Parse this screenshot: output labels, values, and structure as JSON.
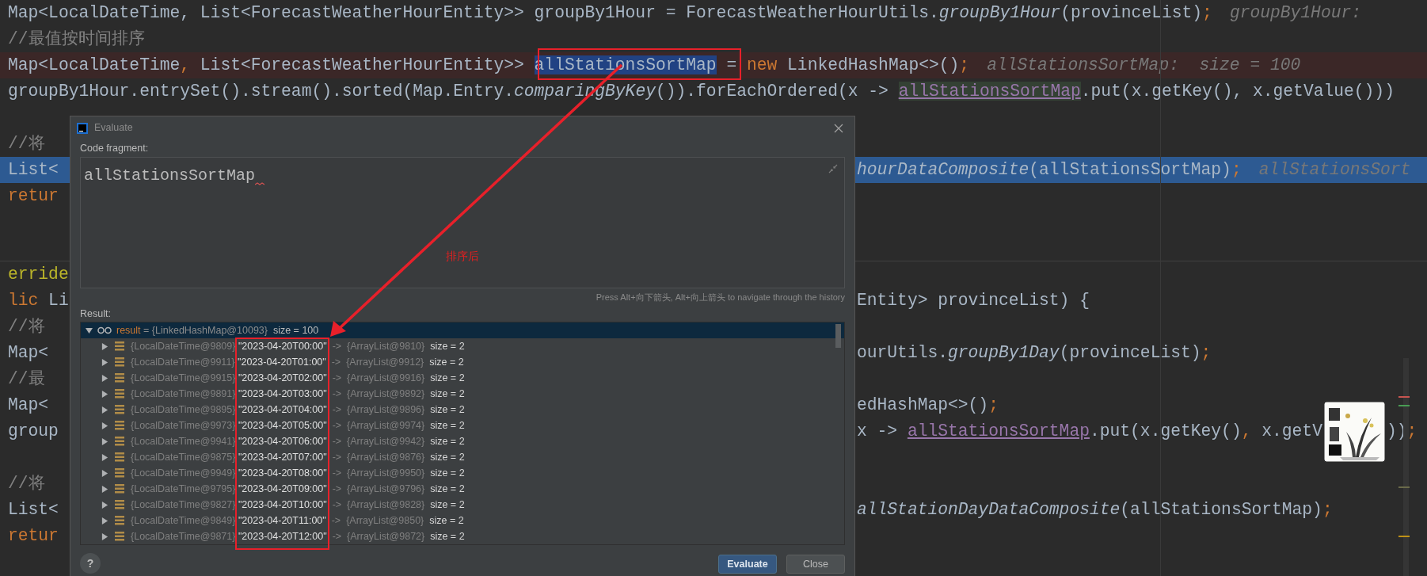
{
  "editor": {
    "lines": [
      {
        "kind": "plain",
        "left": [
          {
            "kind": "plain",
            "text": "Map<LocalDateTime, List<ForecastWeatherHourEntity>> groupBy1Hour = ForecastWeatherHourUtils."
          },
          {
            "kind": "italic",
            "text": "groupBy1Hour"
          },
          {
            "kind": "plain",
            "text": "(provinceList)"
          },
          {
            "kind": "keyword",
            "text": ";"
          },
          {
            "kind": "hint",
            "text": "groupBy1Hour:"
          }
        ]
      },
      {
        "kind": "plain",
        "left": [
          {
            "kind": "comment",
            "text": "//最值按时间排序"
          }
        ]
      },
      {
        "kind": "breakpoint",
        "left": [
          {
            "kind": "plain",
            "text": "Map<LocalDateTime"
          },
          {
            "kind": "keyword",
            "text": ","
          },
          {
            "kind": "plain",
            "text": " List<ForecastWeatherHourEntity>> "
          },
          {
            "kind": "selected",
            "text": "allStationsSortMap"
          },
          {
            "kind": "plain",
            "text": " = "
          },
          {
            "kind": "keyword",
            "text": "new"
          },
          {
            "kind": "plain",
            "text": " LinkedHashMap<>()"
          },
          {
            "kind": "keyword",
            "text": ";"
          },
          {
            "kind": "hint",
            "text": "allStationsSortMap:  size = 100"
          }
        ]
      },
      {
        "kind": "plain",
        "left": [
          {
            "kind": "plain",
            "text": "groupBy1Hour.entrySet().stream().sorted(Map.Entry."
          },
          {
            "kind": "italic",
            "text": "comparingByKey"
          },
          {
            "kind": "plain",
            "text": "()).forEachOrdered(x -> "
          },
          {
            "kind": "usage",
            "text": "allStationsSortMap"
          },
          {
            "kind": "plain",
            "text": ".put(x.getKey(), x.getValue()))"
          }
        ]
      },
      {
        "kind": "plain"
      },
      {
        "kind": "plain",
        "left": [
          {
            "kind": "comment",
            "text": "//将"
          }
        ]
      },
      {
        "kind": "execution",
        "left": [
          {
            "kind": "plain",
            "text": "List<"
          }
        ],
        "right": [
          {
            "kind": "italic",
            "text": "hourDataComposite"
          },
          {
            "kind": "plain",
            "text": "(allStationsSortMap)"
          },
          {
            "kind": "keyword",
            "text": ";"
          },
          {
            "kind": "hint",
            "text": "allStationsSort"
          }
        ]
      },
      {
        "kind": "plain",
        "left": [
          {
            "kind": "keyword",
            "text": "retur"
          }
        ]
      },
      {
        "kind": "plain"
      },
      {
        "kind": "divider"
      },
      {
        "kind": "plain",
        "left": [
          {
            "kind": "annotation",
            "text": "erride"
          }
        ]
      },
      {
        "kind": "plain",
        "left": [
          {
            "kind": "keyword",
            "text": "lic"
          },
          {
            "kind": "plain",
            "text": " Li"
          }
        ],
        "right": [
          {
            "kind": "plain",
            "text": "Entity> provinceList) {"
          }
        ]
      },
      {
        "kind": "plain",
        "left": [
          {
            "kind": "comment",
            "text": "//将"
          }
        ]
      },
      {
        "kind": "plain",
        "left": [
          {
            "kind": "plain",
            "text": "Map<"
          }
        ],
        "right": [
          {
            "kind": "plain",
            "text": "ourUtils."
          },
          {
            "kind": "italic",
            "text": "groupBy1Day"
          },
          {
            "kind": "plain",
            "text": "(provinceList)"
          },
          {
            "kind": "keyword",
            "text": ";"
          }
        ]
      },
      {
        "kind": "plain",
        "left": [
          {
            "kind": "comment",
            "text": "//最"
          }
        ]
      },
      {
        "kind": "plain",
        "left": [
          {
            "kind": "plain",
            "text": "Map<"
          }
        ],
        "right": [
          {
            "kind": "plain",
            "text": "edHashMap<>()"
          },
          {
            "kind": "keyword",
            "text": ";"
          }
        ]
      },
      {
        "kind": "plain",
        "left": [
          {
            "kind": "plain",
            "text": "group"
          }
        ],
        "right": [
          {
            "kind": "plain",
            "text": "x -> "
          },
          {
            "kind": "field",
            "text": "allStationsSortMap"
          },
          {
            "kind": "plain",
            "text": ".put(x.getKey()"
          },
          {
            "kind": "keyword",
            "text": ","
          },
          {
            "kind": "plain",
            "text": " x.getV"
          },
          {
            "kind": "picture"
          },
          {
            "kind": "plain",
            "text": "))"
          },
          {
            "kind": "keyword",
            "text": ";"
          }
        ]
      },
      {
        "kind": "plain"
      },
      {
        "kind": "plain",
        "left": [
          {
            "kind": "comment",
            "text": "//将"
          }
        ]
      },
      {
        "kind": "plain",
        "left": [
          {
            "kind": "plain",
            "text": "List<"
          }
        ],
        "right": [
          {
            "kind": "italic",
            "text": "allStationDayDataComposite"
          },
          {
            "kind": "plain",
            "text": "(allStationsSortMap)"
          },
          {
            "kind": "keyword",
            "text": ";"
          }
        ]
      },
      {
        "kind": "plain",
        "left": [
          {
            "kind": "keyword",
            "text": "retur"
          }
        ]
      }
    ]
  },
  "dialog": {
    "title": "Evaluate",
    "code_label": "Code fragment:",
    "code": "allStationsSortMap",
    "note": "排序后",
    "hint": "Press Alt+向下箭头, Alt+向上箭头 to navigate through the history",
    "result_label": "Result:",
    "result": {
      "selected": true,
      "expanded": true,
      "name": "result",
      "value": " = {LinkedHashMap@10093}",
      "size": "size = 100",
      "children": [
        {
          "selected": false,
          "expanded": false,
          "key_id": "{LocalDateTime@9809}",
          "key": "\"2023-04-20T00:00\"",
          "arrow": "->",
          "value": "{ArrayList@9810}",
          "size": "size = 2"
        },
        {
          "selected": false,
          "expanded": false,
          "key_id": "{LocalDateTime@9911}",
          "key": "\"2023-04-20T01:00\"",
          "arrow": "->",
          "value": "{ArrayList@9912}",
          "size": "size = 2"
        },
        {
          "selected": false,
          "expanded": false,
          "key_id": "{LocalDateTime@9915}",
          "key": "\"2023-04-20T02:00\"",
          "arrow": "->",
          "value": "{ArrayList@9916}",
          "size": "size = 2"
        },
        {
          "selected": false,
          "expanded": false,
          "key_id": "{LocalDateTime@9891}",
          "key": "\"2023-04-20T03:00\"",
          "arrow": "->",
          "value": "{ArrayList@9892}",
          "size": "size = 2"
        },
        {
          "selected": false,
          "expanded": false,
          "key_id": "{LocalDateTime@9895}",
          "key": "\"2023-04-20T04:00\"",
          "arrow": "->",
          "value": "{ArrayList@9896}",
          "size": "size = 2"
        },
        {
          "selected": false,
          "expanded": false,
          "key_id": "{LocalDateTime@9973}",
          "key": "\"2023-04-20T05:00\"",
          "arrow": "->",
          "value": "{ArrayList@9974}",
          "size": "size = 2"
        },
        {
          "selected": false,
          "expanded": false,
          "key_id": "{LocalDateTime@9941}",
          "key": "\"2023-04-20T06:00\"",
          "arrow": "->",
          "value": "{ArrayList@9942}",
          "size": "size = 2"
        },
        {
          "selected": false,
          "expanded": false,
          "key_id": "{LocalDateTime@9875}",
          "key": "\"2023-04-20T07:00\"",
          "arrow": "->",
          "value": "{ArrayList@9876}",
          "size": "size = 2"
        },
        {
          "selected": false,
          "expanded": false,
          "key_id": "{LocalDateTime@9949}",
          "key": "\"2023-04-20T08:00\"",
          "arrow": "->",
          "value": "{ArrayList@9950}",
          "size": "size = 2"
        },
        {
          "selected": false,
          "expanded": false,
          "key_id": "{LocalDateTime@9795}",
          "key": "\"2023-04-20T09:00\"",
          "arrow": "->",
          "value": "{ArrayList@9796}",
          "size": "size = 2"
        },
        {
          "selected": false,
          "expanded": false,
          "key_id": "{LocalDateTime@9827}",
          "key": "\"2023-04-20T10:00\"",
          "arrow": "->",
          "value": "{ArrayList@9828}",
          "size": "size = 2"
        },
        {
          "selected": false,
          "expanded": false,
          "key_id": "{LocalDateTime@9849}",
          "key": "\"2023-04-20T11:00\"",
          "arrow": "->",
          "value": "{ArrayList@9850}",
          "size": "size = 2"
        },
        {
          "selected": false,
          "expanded": false,
          "key_id": "{LocalDateTime@9871}",
          "key": "\"2023-04-20T12:00\"",
          "arrow": "->",
          "value": "{ArrayList@9872}",
          "size": "size = 2"
        }
      ]
    },
    "help": "?",
    "buttons": [
      {
        "label": "Evaluate",
        "kind": "primary"
      },
      {
        "label": "Close",
        "kind": "secondary"
      }
    ]
  }
}
